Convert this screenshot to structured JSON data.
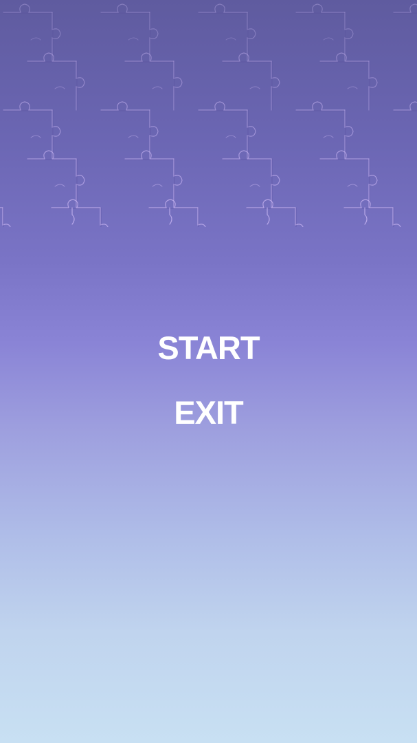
{
  "menu": {
    "start_label": "START",
    "exit_label": "EXIT"
  },
  "background": {
    "type": "jigsaw-puzzle-pattern",
    "colors": {
      "top": "#5f5b9f",
      "middle": "#8a84d6",
      "bottom": "#c8e0f3",
      "edge_light": "#c9b6f2",
      "edge_dark": "#4a3f8f"
    }
  }
}
